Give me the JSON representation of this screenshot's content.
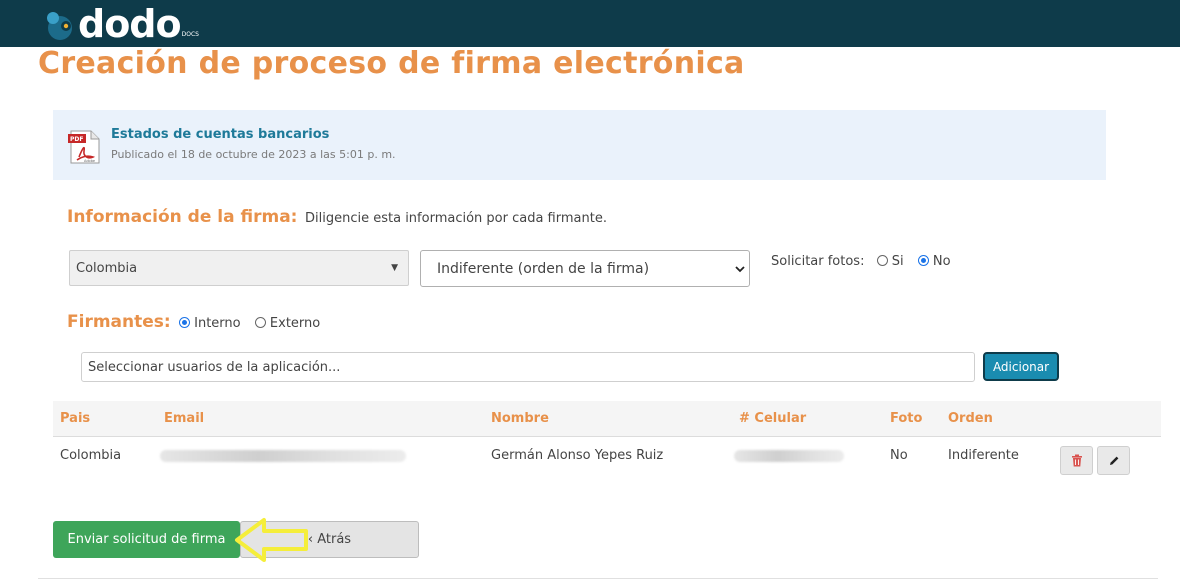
{
  "brand": {
    "logo_text": "dodo",
    "logo_sub": "DOCS"
  },
  "page": {
    "title": "Creación de proceso de firma electrónica"
  },
  "document": {
    "icon": "pdf-file-icon",
    "title": "Estados de cuentas bancarios",
    "subtitle": "Publicado el 18 de octubre de 2023 a las 5:01 p. m."
  },
  "signature_info": {
    "label": "Información de la firma:",
    "hint": "Diligencie esta información por cada firmante.",
    "country": "Colombia",
    "order": "Indiferente (orden de la firma)",
    "photos_label": "Solicitar fotos:",
    "photos_yes": "Si",
    "photos_no": "No",
    "photos_selected": "No"
  },
  "signers": {
    "label": "Firmantes:",
    "internal": "Interno",
    "external": "Externo",
    "selected": "Interno",
    "search_placeholder": "Seleccionar usuarios de la aplicación...",
    "add_label": "Adicionar"
  },
  "table": {
    "headers": [
      "Pais",
      "Email",
      "Nombre",
      "# Celular",
      "Foto",
      "Orden"
    ],
    "rows": [
      {
        "pais": "Colombia",
        "nombre": "Germán Alonso Yepes Ruiz",
        "foto": "No",
        "orden": "Indiferente"
      }
    ]
  },
  "actions": {
    "send_label": "Enviar solicitud de firma",
    "back_label": "‹ Atrás"
  },
  "colors": {
    "accent": "#e8914a",
    "topbar": "#0e3b4a",
    "link": "#1e7a99",
    "send": "#3ea55a",
    "add": "#1a8cb0",
    "highlight_arrow": "#f5ee3a"
  }
}
